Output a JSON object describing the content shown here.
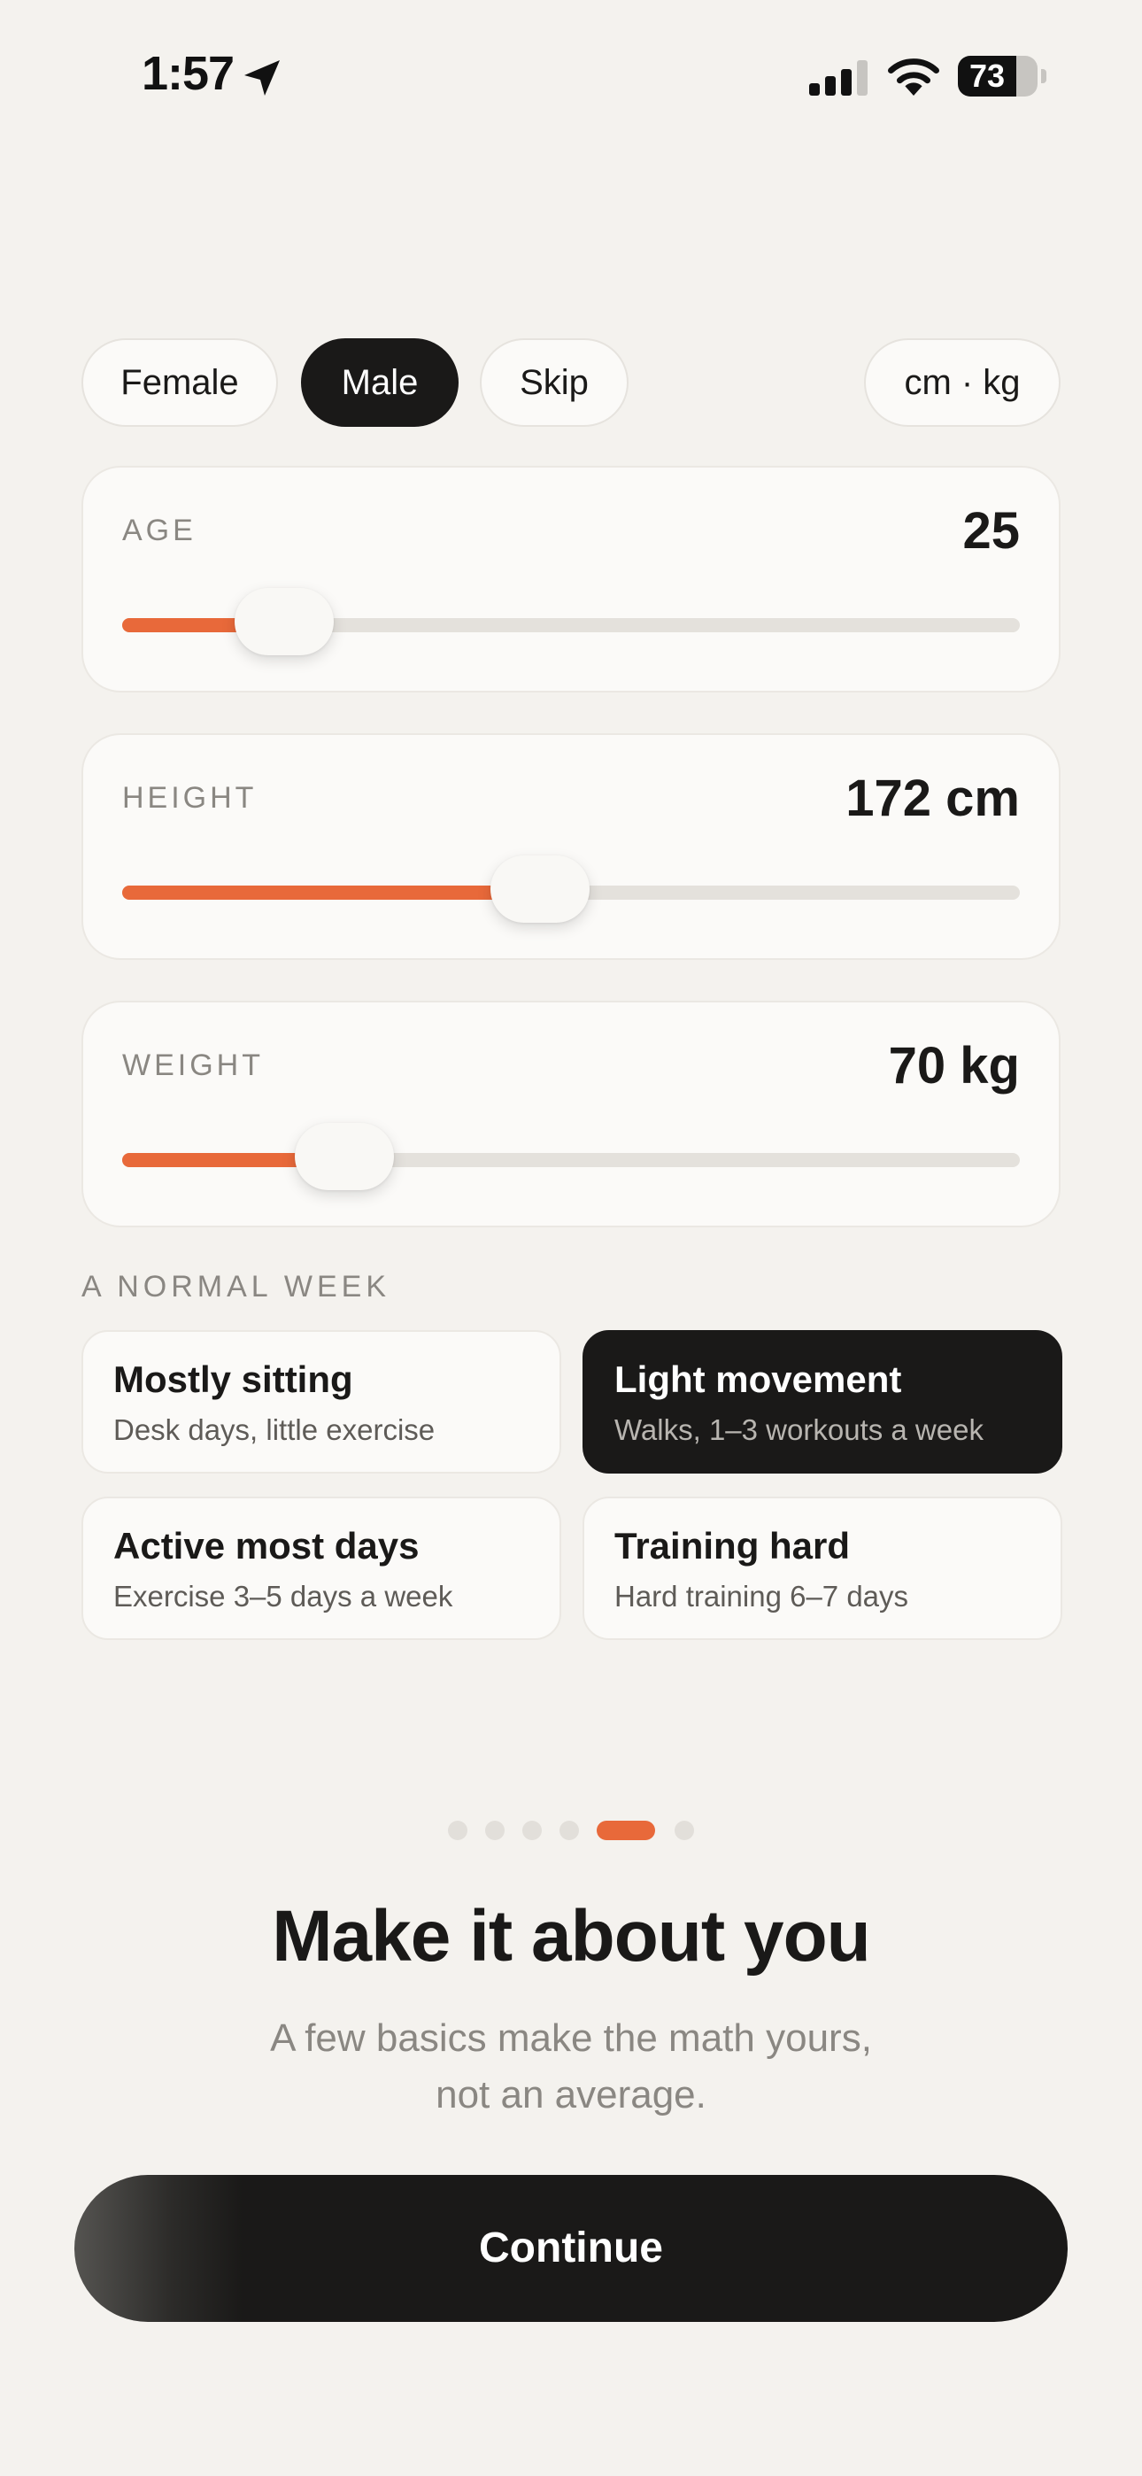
{
  "status_bar": {
    "time": "1:57",
    "battery": "73",
    "battery_level": 0.73,
    "icons": [
      "location-arrow-icon",
      "cellular-signal-icon",
      "wifi-icon",
      "battery-icon"
    ]
  },
  "gender": {
    "options": [
      "Female",
      "Male",
      "Skip"
    ],
    "selected": "Male"
  },
  "units_label": "cm · kg",
  "sliders": [
    {
      "label": "AGE",
      "value": "25",
      "fraction": 0.18
    },
    {
      "label": "HEIGHT",
      "value": "172 cm",
      "fraction": 0.465
    },
    {
      "label": "WEIGHT",
      "value": "70 kg",
      "fraction": 0.248
    }
  ],
  "week": {
    "label": "A NORMAL WEEK",
    "options": [
      {
        "title": "Mostly sitting",
        "subtitle": "Desk days, little exercise"
      },
      {
        "title": "Light movement",
        "subtitle": "Walks, 1–3 workouts a week"
      },
      {
        "title": "Active most days",
        "subtitle": "Exercise 3–5 days a week"
      },
      {
        "title": "Training hard",
        "subtitle": "Hard training 6–7 days"
      }
    ],
    "selected": "Light movement"
  },
  "pagination": {
    "total": 6,
    "current": 5
  },
  "title": "Make it about you",
  "subtitle_line1": "A few basics make the math yours,",
  "subtitle_line2": "not an average.",
  "continue_label": "Continue",
  "colors": {
    "accent": "#e8693a",
    "dark": "#1a1918",
    "background": "#f4f2ee",
    "card": "#fbfaf8",
    "muted": "#8a8782"
  }
}
